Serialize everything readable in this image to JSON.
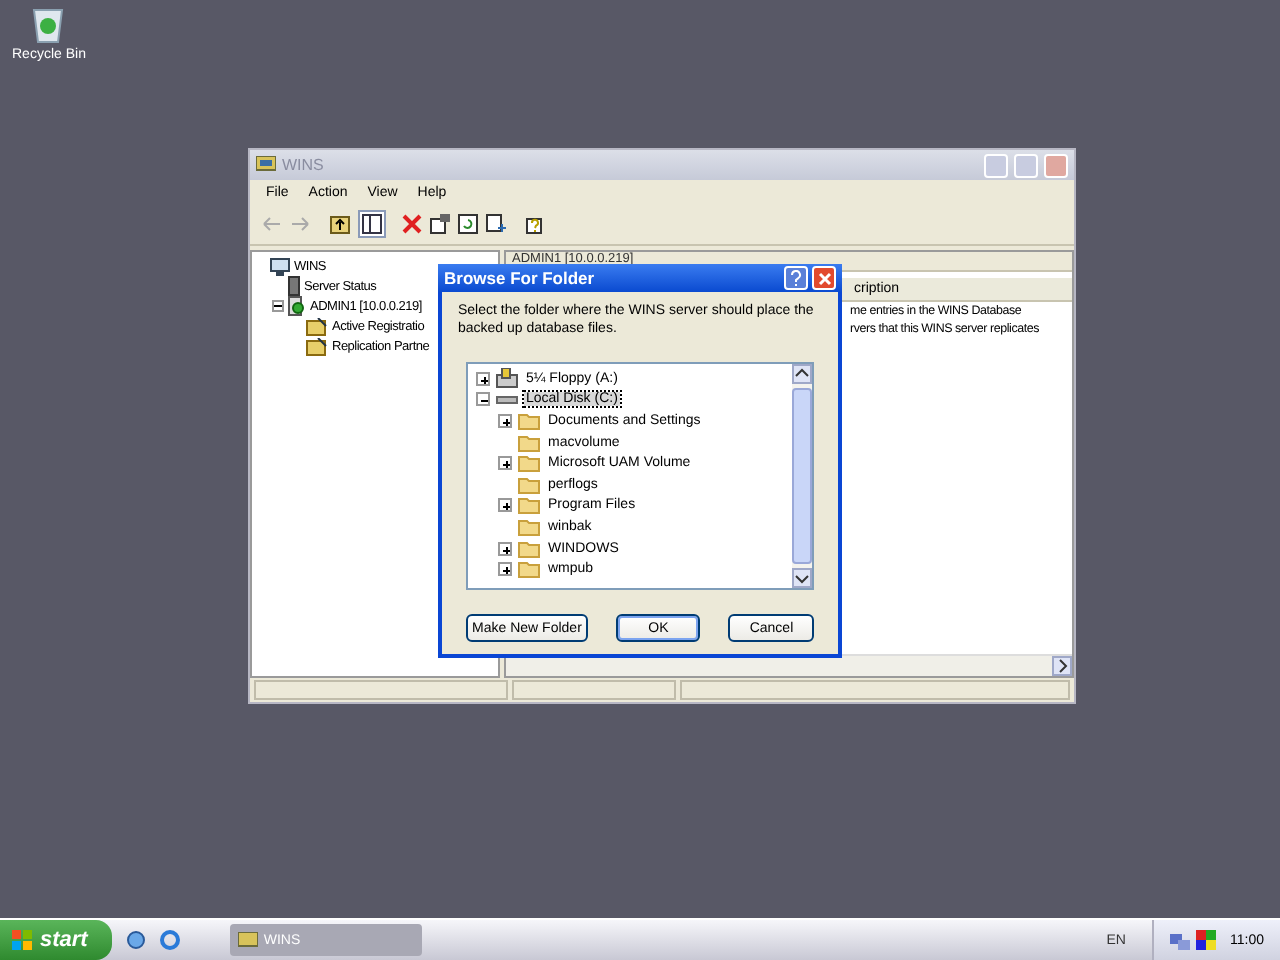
{
  "desktop_icons": [
    {
      "label": "Recycle Bin"
    }
  ],
  "wins_window": {
    "title": "WINS",
    "menu": [
      "File",
      "Action",
      "View",
      "Help"
    ],
    "tree": [
      {
        "label": "WINS",
        "kind": "root",
        "children": [
          {
            "label": "Server Status",
            "kind": "status"
          },
          {
            "label": "ADMIN1 [10.0.0.219]",
            "kind": "server",
            "expanded": true,
            "children": [
              {
                "label": "Active Registratio",
                "kind": "folder"
              },
              {
                "label": "Replication Partne",
                "kind": "folder"
              }
            ]
          }
        ]
      }
    ],
    "pane_header": "ADMIN1 [10.0.0.219]",
    "column": "cription",
    "rows": [
      "me entries in the WINS Database",
      "rvers that this WINS server replicates"
    ]
  },
  "dialog": {
    "title": "Browse For Folder",
    "instruction": "Select the folder where the WINS server should place the backed up database files.",
    "tree": [
      {
        "label": "5¼ Floppy (A:)",
        "kind": "floppy",
        "expanded": false,
        "selected": false
      },
      {
        "label": "Local Disk (C:)",
        "kind": "disk",
        "expanded": true,
        "selected": true,
        "children": [
          {
            "label": "Documents and Settings",
            "expandable": true
          },
          {
            "label": "macvolume",
            "expandable": false
          },
          {
            "label": "Microsoft UAM Volume",
            "expandable": true
          },
          {
            "label": "perflogs",
            "expandable": false
          },
          {
            "label": "Program Files",
            "expandable": true
          },
          {
            "label": "winbak",
            "expandable": false
          },
          {
            "label": "WINDOWS",
            "expandable": true
          },
          {
            "label": "wmpub",
            "expandable": true
          }
        ]
      }
    ],
    "buttons": [
      {
        "label": "Make New Folder",
        "default": false
      },
      {
        "label": "OK",
        "default": true
      },
      {
        "label": "Cancel",
        "default": false
      }
    ]
  },
  "taskbar": {
    "start": "start",
    "tasks": [
      {
        "label": "WINS"
      }
    ],
    "language": "EN",
    "clock": "11:00"
  }
}
